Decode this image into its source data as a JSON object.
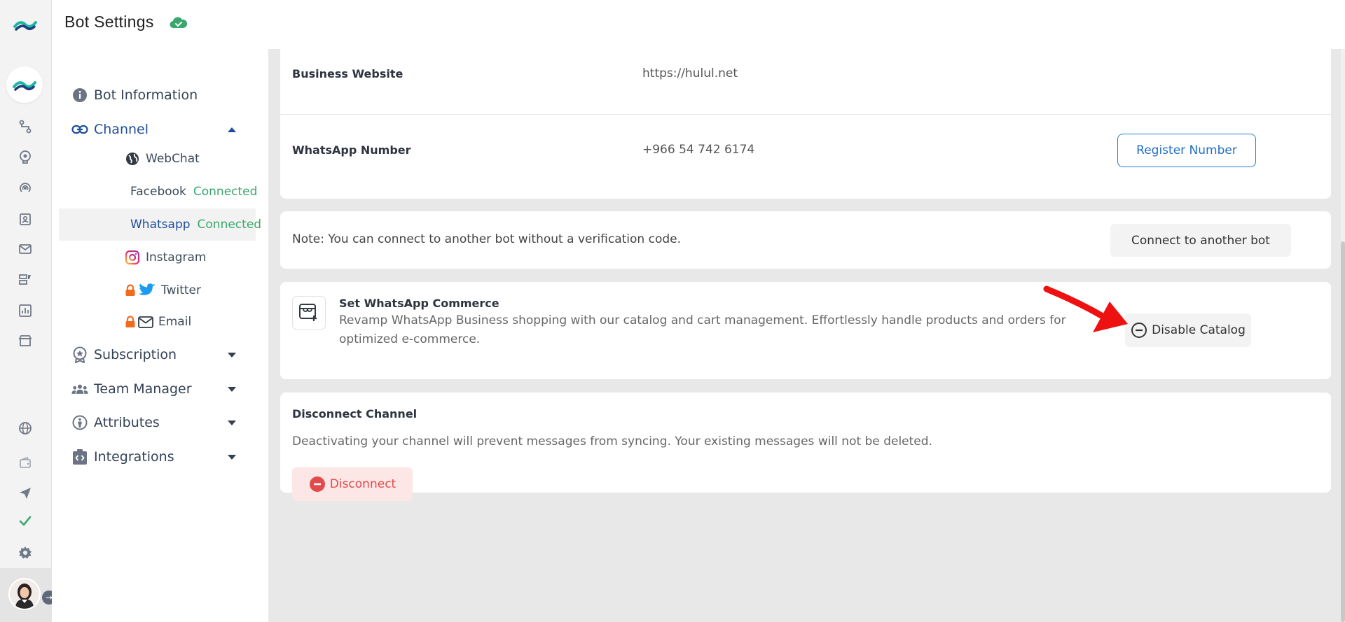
{
  "header": {
    "title": "Bot Settings"
  },
  "sidebar": {
    "bot_information": "Bot Information",
    "channel": "Channel",
    "channels": [
      {
        "label": "WebChat",
        "status": ""
      },
      {
        "label": "Facebook",
        "status": "Connected"
      },
      {
        "label": "Whatsapp",
        "status": "Connected"
      },
      {
        "label": "Instagram",
        "status": ""
      },
      {
        "label": "Twitter",
        "status": ""
      },
      {
        "label": "Email",
        "status": ""
      }
    ],
    "subscription": "Subscription",
    "team_manager": "Team Manager",
    "attributes": "Attributes",
    "integrations": "Integrations"
  },
  "main": {
    "business_website_label": "Business Website",
    "business_website_value": "https://hulul.net",
    "whatsapp_number_label": "WhatsApp Number",
    "whatsapp_number_value": "+966 54 742 6174",
    "register_number_button": "Register Number",
    "note_text": "Note: You can connect to another bot without a verification code.",
    "connect_another_bot_button": "Connect to another bot",
    "commerce_title": "Set WhatsApp Commerce",
    "commerce_desc_line1": "Revamp WhatsApp Business shopping with our catalog and cart management. Effortlessly handle products and orders for",
    "commerce_desc_line2": "optimized e-commerce.",
    "disable_catalog_button": "Disable Catalog",
    "disconnect_title": "Disconnect Channel",
    "disconnect_desc": "Deactivating your channel will prevent messages from syncing. Your existing messages will not be deleted.",
    "disconnect_button": "Disconnect"
  },
  "colors": {
    "brand_teal": "#1fb6a6",
    "brand_navy": "#1f4e98",
    "connected_green": "#3aa76d",
    "danger_red": "#e24b4b",
    "arrow_red": "#ee1111"
  }
}
